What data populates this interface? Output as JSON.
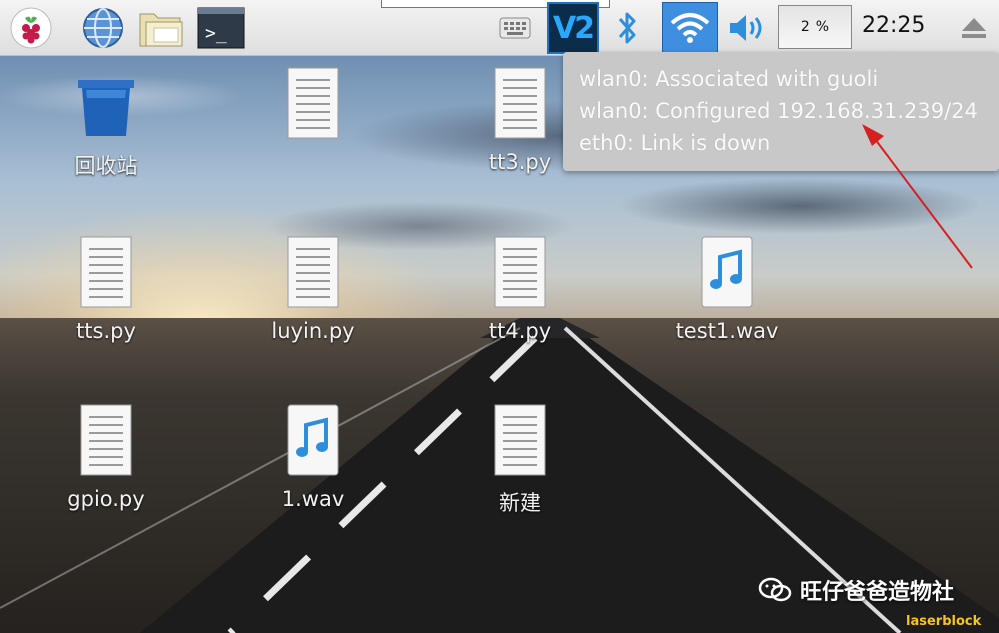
{
  "taskbar": {
    "launchers": [
      {
        "name": "raspberry-menu-icon"
      },
      {
        "name": "browser-globe-icon"
      },
      {
        "name": "file-manager-icon"
      },
      {
        "name": "terminal-icon"
      }
    ],
    "terminal_glyph": ">_",
    "vnc_label": "V2",
    "cpu_percent": "2",
    "cpu_unit": "%",
    "clock": "22:25"
  },
  "tooltip": {
    "lines": [
      "wlan0: Associated with guoli",
      "wlan0: Configured 192.168.31.239/24",
      "eth0: Link is down"
    ]
  },
  "desktop": {
    "icons": [
      {
        "label": "回收站",
        "type": "trash"
      },
      {
        "label": "",
        "type": "text"
      },
      {
        "label": "tt3.py",
        "type": "text"
      },
      {
        "label": "tts.py",
        "type": "text"
      },
      {
        "label": "luyin.py",
        "type": "text"
      },
      {
        "label": "tt4.py",
        "type": "text"
      },
      {
        "label": "test1.wav",
        "type": "audio"
      },
      {
        "label": "gpio.py",
        "type": "text"
      },
      {
        "label": "1.wav",
        "type": "audio"
      },
      {
        "label": "新建",
        "type": "text"
      }
    ]
  },
  "watermark": {
    "text": "旺仔爸爸造物社",
    "brand": "laserblock"
  },
  "colors": {
    "accent_blue": "#2d8fdc",
    "annotation_red": "#d42020",
    "tooltip_bg": "#c8c8c8"
  }
}
